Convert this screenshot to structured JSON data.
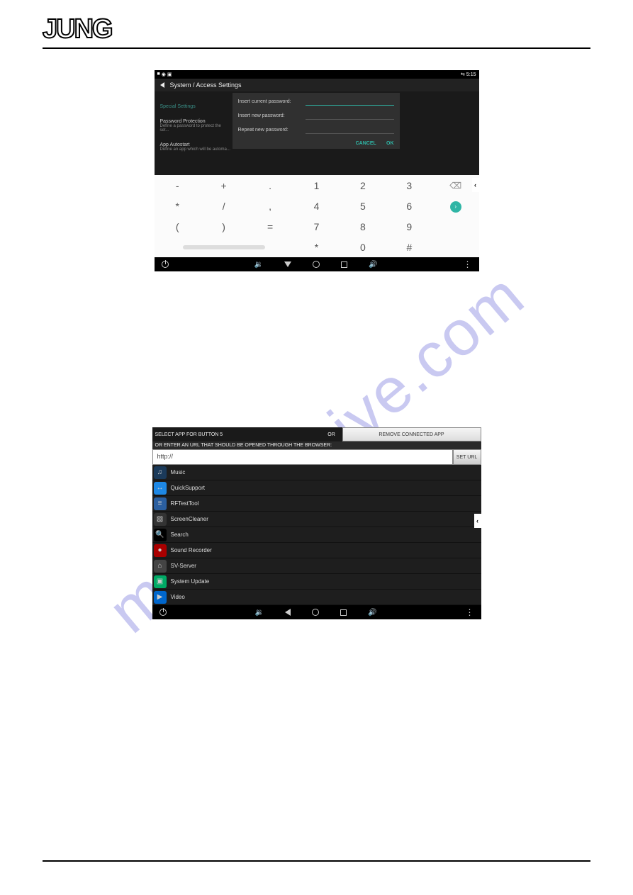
{
  "brand": "JUNG",
  "watermark": "manualshive.com",
  "shot1": {
    "status_time": "5:15",
    "title": "System / Access Settings",
    "menu": {
      "item1": "Special Settings",
      "item2_t": "Password Protection",
      "item2_d": "Define a password to protect the set...",
      "item3_t": "App Autostart",
      "item3_d": "Define an app which will be automa..."
    },
    "dialog": {
      "lbl_current": "Insert current password:",
      "lbl_new": "Insert new password:",
      "lbl_repeat": "Repeat new password:",
      "cancel": "CANCEL",
      "ok": "OK"
    },
    "keypad": {
      "r1": [
        "-",
        "+",
        ".",
        "1",
        "2",
        "3"
      ],
      "r2": [
        "*",
        "/",
        ",",
        "4",
        "5",
        "6"
      ],
      "r3": [
        "(",
        ")",
        "=",
        "7",
        "8",
        "9"
      ],
      "r4": [
        "",
        "",
        "",
        "*",
        "0",
        "#"
      ]
    }
  },
  "shot2": {
    "header_left": "SELECT APP FOR BUTTON 5",
    "header_or": "OR",
    "header_right": "REMOVE CONNECTED APP",
    "subheader": "OR ENTER AN URL THAT SHOULD BE OPENED THROUGH THE BROWSER:",
    "url_value": "http://",
    "url_btn": "SET URL",
    "apps": [
      {
        "label": "Music",
        "bg": "#1b3a5a",
        "sym": "♫"
      },
      {
        "label": "QuickSupport",
        "bg": "#1e88e5",
        "sym": "↔"
      },
      {
        "label": "RFTestTool",
        "bg": "#2b5fa0",
        "sym": "≡"
      },
      {
        "label": "ScreenCleaner",
        "bg": "#333",
        "sym": "▧"
      },
      {
        "label": "Search",
        "bg": "#000",
        "sym": "🔍"
      },
      {
        "label": "Sound Recorder",
        "bg": "#a00",
        "sym": "●"
      },
      {
        "label": "SV-Server",
        "bg": "#444",
        "sym": "⌂"
      },
      {
        "label": "System Update",
        "bg": "#0a6",
        "sym": "▣"
      },
      {
        "label": "Video",
        "bg": "#06c",
        "sym": "▶"
      }
    ]
  }
}
